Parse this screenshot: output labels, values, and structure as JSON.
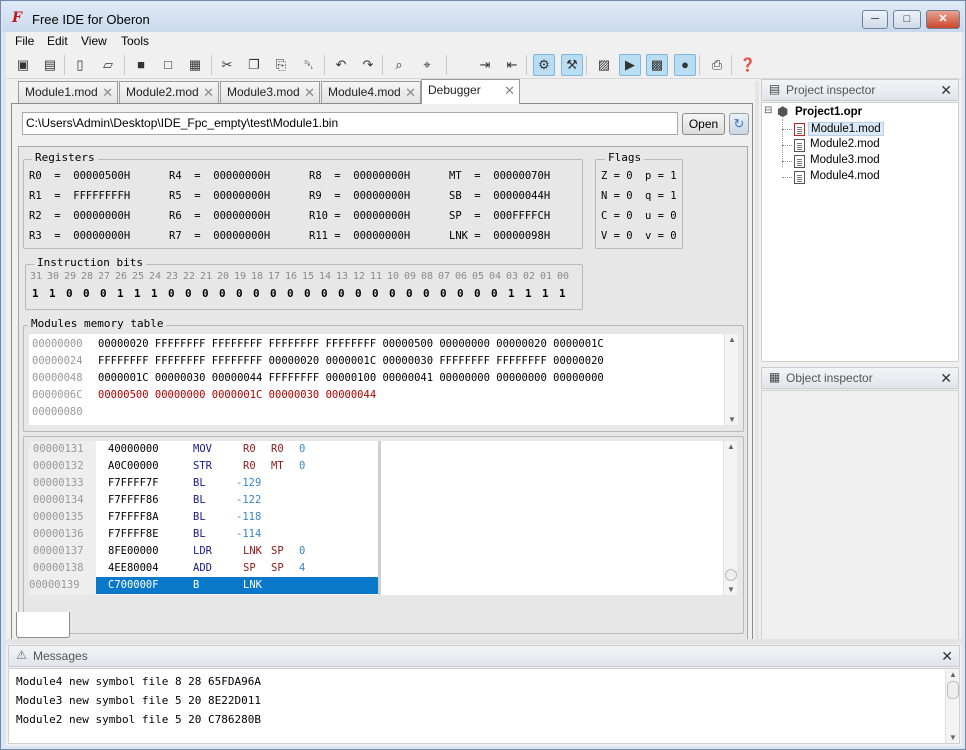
{
  "window": {
    "title": "Free IDE for Oberon"
  },
  "menu": [
    "File",
    "Edit",
    "View",
    "Tools"
  ],
  "toolbar_icons": [
    "new-project-icon",
    "open-project-icon",
    "new-file-icon",
    "open-file-icon",
    "save-icon",
    "save-as-icon",
    "save-all-icon",
    "cut-icon",
    "copy-icon",
    "paste-icon",
    "delete-icon",
    "undo-icon",
    "redo-icon",
    "find-icon",
    "find-next-icon",
    "indent-icon",
    "outdent-icon",
    "settings-icon",
    "tools-icon",
    "compile-icon",
    "run-icon",
    "debug-icon",
    "stop-debug-icon",
    "print-icon",
    "help-icon"
  ],
  "tabs": [
    {
      "label": "Module1.mod"
    },
    {
      "label": "Module2.mod"
    },
    {
      "label": "Module3.mod"
    },
    {
      "label": "Module4.mod"
    },
    {
      "label": "Debugger",
      "active": true
    }
  ],
  "debugger": {
    "path": "C:\\Users\\Admin\\Desktop\\IDE_Fpc_empty\\test\\Module1.bin",
    "open_label": "Open",
    "registers_title": "Registers",
    "registers": [
      [
        "R0  =  00000500H",
        "R4  =  00000000H",
        "R8  =  00000000H",
        "MT  =  00000070H"
      ],
      [
        "R1  =  FFFFFFFFH",
        "R5  =  00000000H",
        "R9  =  00000000H",
        "SB  =  00000044H"
      ],
      [
        "R2  =  00000000H",
        "R6  =  00000000H",
        "R10 =  00000000H",
        "SP  =  000FFFFCH"
      ],
      [
        "R3  =  00000000H",
        "R7  =  00000000H",
        "R11 =  00000000H",
        "LNK =  00000098H"
      ]
    ],
    "flags_title": "Flags",
    "flags": [
      [
        "Z = 0",
        "p = 1"
      ],
      [
        "N = 0",
        "q = 1"
      ],
      [
        "C = 0",
        "u = 0"
      ],
      [
        "V = 0",
        "v = 0"
      ]
    ],
    "instr_title": "Instruction bits",
    "bit_numbers": [
      "31",
      "30",
      "29",
      "28",
      "27",
      "26",
      "25",
      "24",
      "23",
      "22",
      "21",
      "20",
      "19",
      "18",
      "17",
      "16",
      "15",
      "14",
      "13",
      "12",
      "11",
      "10",
      "09",
      "08",
      "07",
      "06",
      "05",
      "04",
      "03",
      "02",
      "01",
      "00"
    ],
    "bit_values": [
      "1",
      "1",
      "0",
      "0",
      "0",
      "1",
      "1",
      "1",
      "0",
      "0",
      "0",
      "0",
      "0",
      "0",
      "0",
      "0",
      "0",
      "0",
      "0",
      "0",
      "0",
      "0",
      "0",
      "0",
      "0",
      "0",
      "0",
      "0",
      "1",
      "1",
      "1",
      "1"
    ],
    "memory_title": "Modules memory table",
    "memory": [
      {
        "addr": "00000000",
        "data": "00000020 FFFFFFFF FFFFFFFF FFFFFFFF FFFFFFFF 00000500 00000000 00000020 0000001C"
      },
      {
        "addr": "00000024",
        "data": "FFFFFFFF FFFFFFFF FFFFFFFF 00000020 0000001C 00000030 FFFFFFFF FFFFFFFF 00000020"
      },
      {
        "addr": "00000048",
        "data": "0000001C 00000030 00000044 FFFFFFFF 00000100 00000041 00000000 00000000 00000000"
      },
      {
        "addr": "0000006C",
        "data": "00000500 00000000 0000001C 00000030 00000044",
        "red": true
      },
      {
        "addr": "00000080",
        "data": ""
      }
    ],
    "code": [
      {
        "addr": "00000131",
        "hex": "40000000",
        "op": "MOV",
        "a": "R0",
        "b": "R0",
        "imm": "0"
      },
      {
        "addr": "00000132",
        "hex": "A0C00000",
        "op": "STR",
        "a": "R0",
        "b": "MT",
        "imm": "0"
      },
      {
        "addr": "00000133",
        "hex": "F7FFFF7F",
        "op": "BL",
        "a": "",
        "b": "",
        "imm": "-129"
      },
      {
        "addr": "00000134",
        "hex": "F7FFFF86",
        "op": "BL",
        "a": "",
        "b": "",
        "imm": "-122"
      },
      {
        "addr": "00000135",
        "hex": "F7FFFF8A",
        "op": "BL",
        "a": "",
        "b": "",
        "imm": "-118"
      },
      {
        "addr": "00000136",
        "hex": "F7FFFF8E",
        "op": "BL",
        "a": "",
        "b": "",
        "imm": "-114"
      },
      {
        "addr": "00000137",
        "hex": "8FE00000",
        "op": "LDR",
        "a": "LNK",
        "b": "SP",
        "imm": "0"
      },
      {
        "addr": "00000138",
        "hex": "4EE80004",
        "op": "ADD",
        "a": "SP",
        "b": "SP",
        "imm": "4"
      },
      {
        "addr": "00000139",
        "hex": "C700000F",
        "op": "B",
        "a": "LNK",
        "b": "",
        "imm": "",
        "selected": true
      }
    ]
  },
  "project_inspector": {
    "title": "Project inspector",
    "project": "Project1.opr",
    "files": [
      "Module1.mod",
      "Module2.mod",
      "Module3.mod",
      "Module4.mod"
    ],
    "selected": "Module1.mod"
  },
  "object_inspector": {
    "title": "Object inspector"
  },
  "messages": {
    "title": "Messages",
    "lines": [
      "Module4 new symbol file 8 28 65FDA96A",
      "Module3 new symbol file 5 20 8E22D011",
      "Module2 new symbol file 5 20 C786280B"
    ]
  },
  "colors": {
    "selection": "#0a78c8",
    "memory_red": "#b00000",
    "opcode": "#1a1a8a",
    "register": "#8b1a1a",
    "immediate": "#3a86c8"
  }
}
